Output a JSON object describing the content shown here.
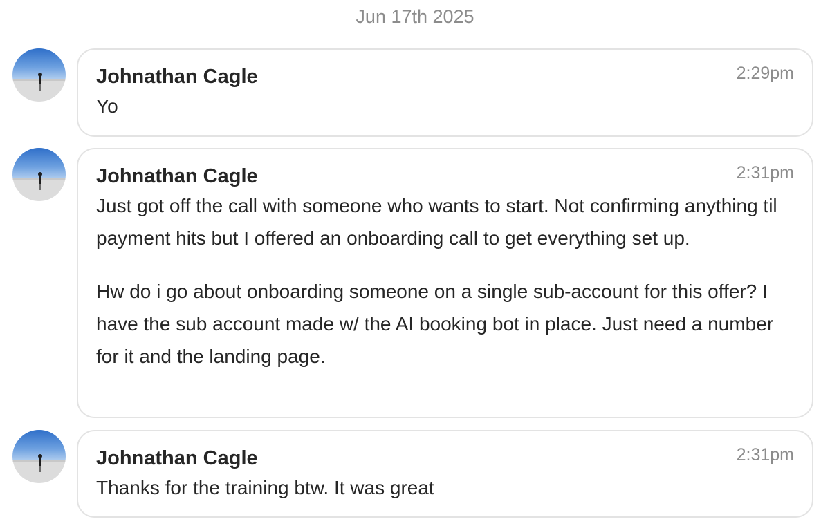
{
  "date_divider": "Jun 17th 2025",
  "messages": [
    {
      "sender": "Johnathan Cagle",
      "time": "2:29pm",
      "paragraphs": [
        "Yo"
      ]
    },
    {
      "sender": "Johnathan Cagle",
      "time": "2:31pm",
      "paragraphs": [
        "Just got off the call with someone who wants to start. Not confirming anything til payment hits but I offered an onboarding call to get everything set up.",
        "Hw do i go about onboarding someone on a single sub-account for this offer? I have the sub account made w/ the AI booking bot in place. Just need a number for it and the landing page."
      ]
    },
    {
      "sender": "Johnathan Cagle",
      "time": "2:31pm",
      "paragraphs": [
        "Thanks for the training btw. It was great"
      ]
    }
  ],
  "colors": {
    "meta_text": "#8c8c8c",
    "body_text": "#262626",
    "bubble_border": "#e3e3e3",
    "avatar_sky_top": "#2f6fc9",
    "avatar_sky_bottom": "#a9c9ee",
    "avatar_ground": "#dcdcdc"
  },
  "icons": {
    "avatar": "profile-photo-person-on-salt-flat"
  }
}
